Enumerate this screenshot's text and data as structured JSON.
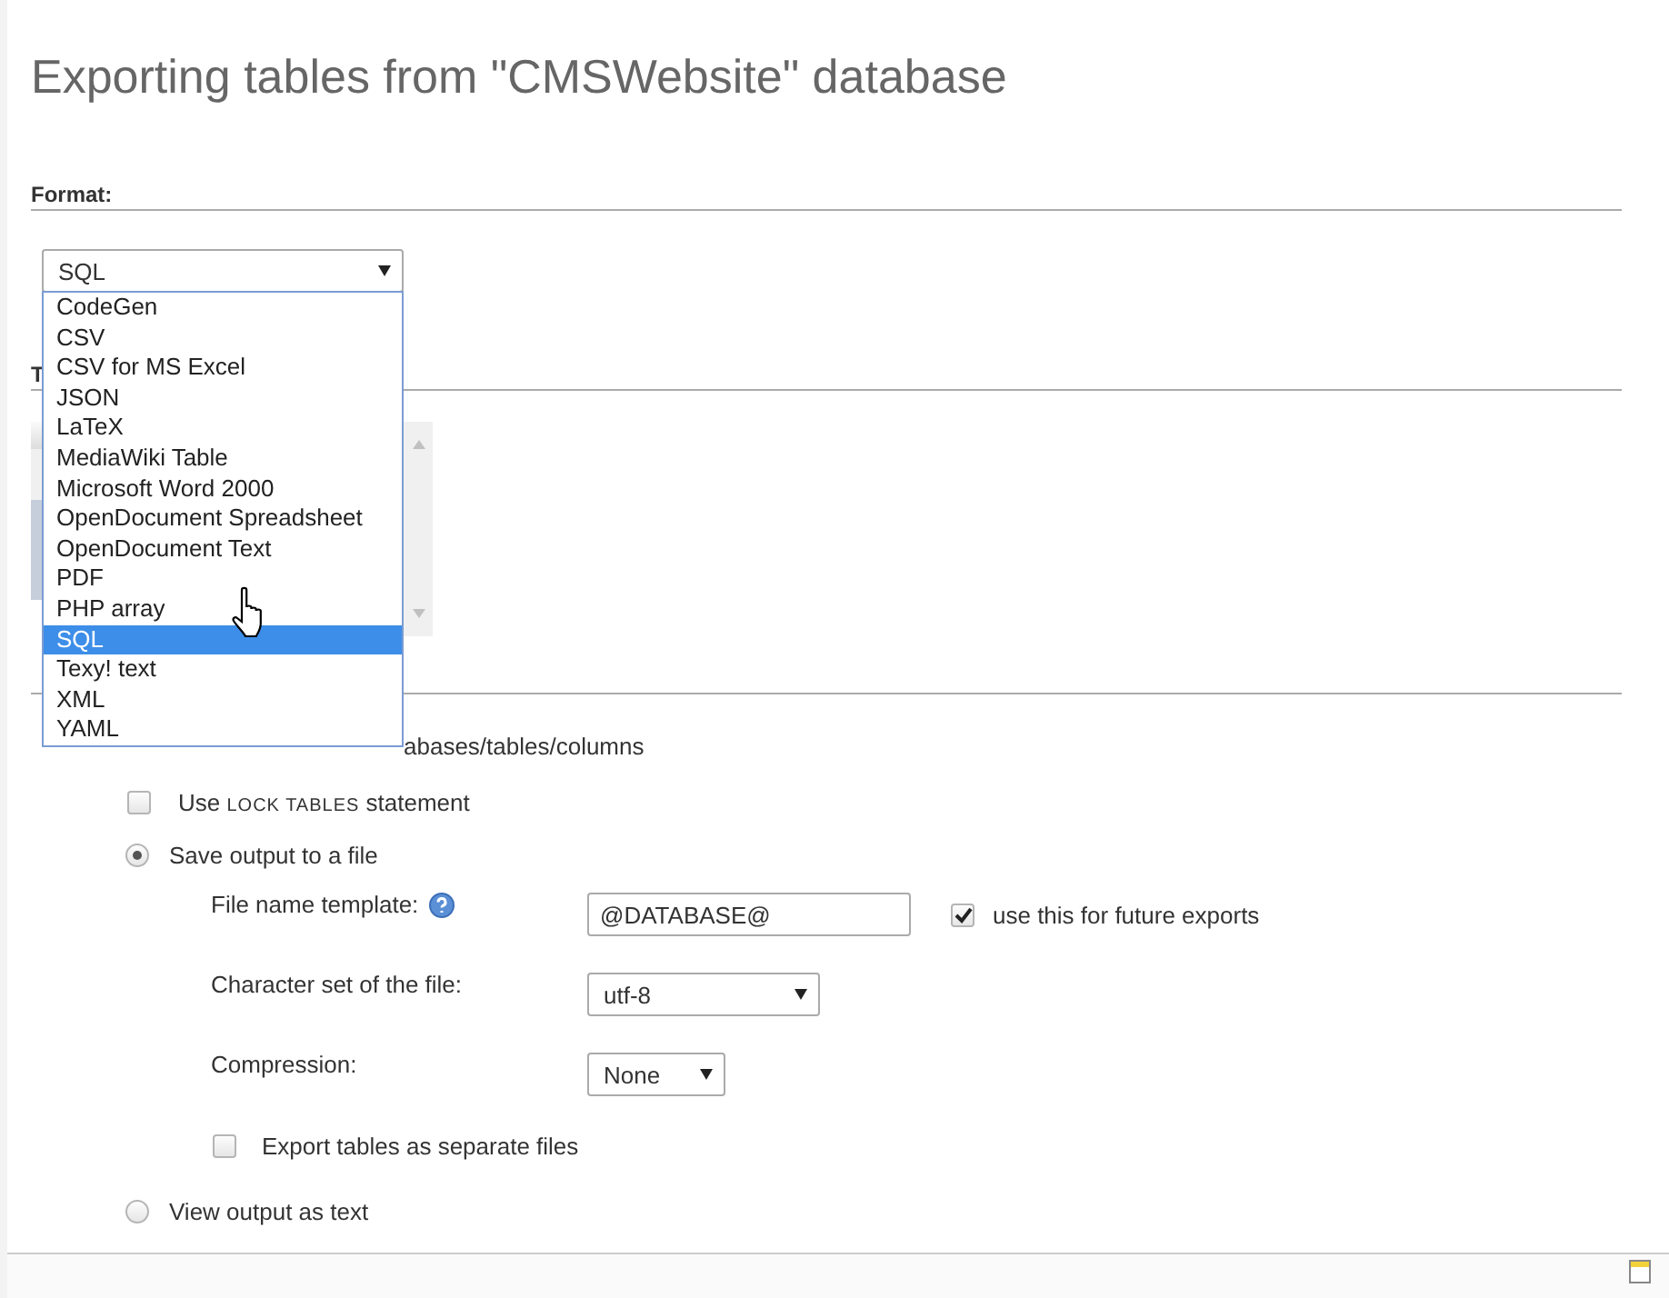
{
  "title": "Exporting tables from \"CMSWebsite\" database",
  "format": {
    "heading": "Format:",
    "value": "SQL",
    "expanded": true,
    "options": [
      {
        "label": "CodeGen",
        "selected": false
      },
      {
        "label": "CSV",
        "selected": false
      },
      {
        "label": "CSV for MS Excel",
        "selected": false
      },
      {
        "label": "JSON",
        "selected": false
      },
      {
        "label": "LaTeX",
        "selected": false
      },
      {
        "label": "MediaWiki Table",
        "selected": false
      },
      {
        "label": "Microsoft Word 2000",
        "selected": false
      },
      {
        "label": "OpenDocument Spreadsheet",
        "selected": false
      },
      {
        "label": "OpenDocument Text",
        "selected": false
      },
      {
        "label": "PDF",
        "selected": false
      },
      {
        "label": "PHP array",
        "selected": false
      },
      {
        "label": "SQL",
        "selected": true
      },
      {
        "label": "Texy! text",
        "selected": false
      },
      {
        "label": "XML",
        "selected": false
      },
      {
        "label": "YAML",
        "selected": false
      }
    ]
  },
  "tables_section": {
    "heading": "T"
  },
  "output_section": {
    "partial_option": "abases/tables/columns",
    "lock_tables": {
      "before": "Use",
      "code": "LOCK TABLES",
      "after": "statement",
      "checked": false
    },
    "save_to_file": {
      "label": "Save output to a file",
      "selected": true
    },
    "file_name_template": {
      "label": "File name template:",
      "value": "@DATABASE@",
      "remember": {
        "label": "use this for future exports",
        "checked": true
      }
    },
    "charset": {
      "label": "Character set of the file:",
      "value": "utf-8"
    },
    "compression": {
      "label": "Compression:",
      "value": "None"
    },
    "separate_files": {
      "label": "Export tables as separate files",
      "checked": false
    },
    "view_as_text": {
      "label": "View output as text",
      "selected": false
    }
  }
}
